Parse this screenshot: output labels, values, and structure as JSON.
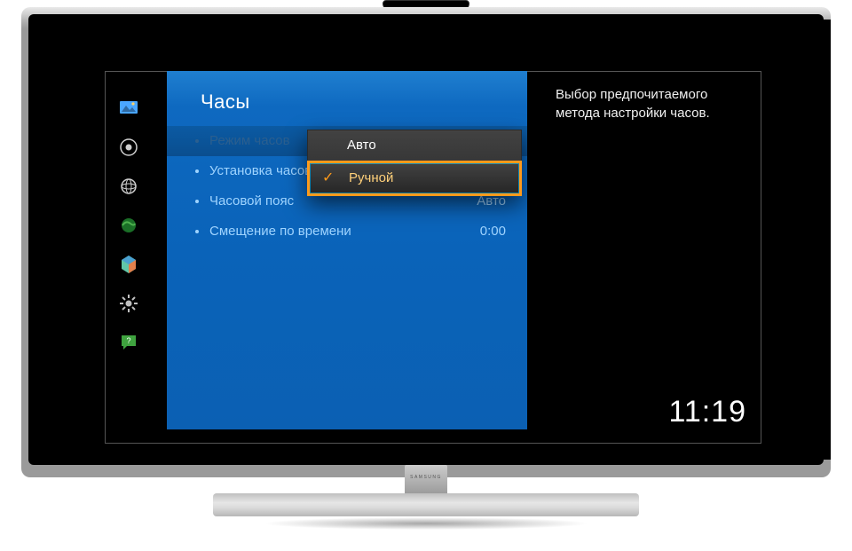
{
  "tv_brand": "SAMSUNG",
  "panel_title": "Часы",
  "menu_items": [
    {
      "label": "Режим часов",
      "value": ""
    },
    {
      "label": "Установка часов",
      "value": ""
    },
    {
      "label": "Часовой пояс",
      "value": "Авто"
    },
    {
      "label": "Смещение по времени",
      "value": "0:00"
    }
  ],
  "dropdown": {
    "options": [
      {
        "label": "Авто",
        "selected": false
      },
      {
        "label": "Ручной",
        "selected": true
      }
    ]
  },
  "help_text": "Выбор предпочитаемого метода настройки часов.",
  "clock_text": "11:19",
  "sidebar_icons": [
    "picture-icon",
    "sound-icon",
    "network-icon",
    "broadcast-icon",
    "smart-hub-icon",
    "settings-icon",
    "support-icon"
  ]
}
